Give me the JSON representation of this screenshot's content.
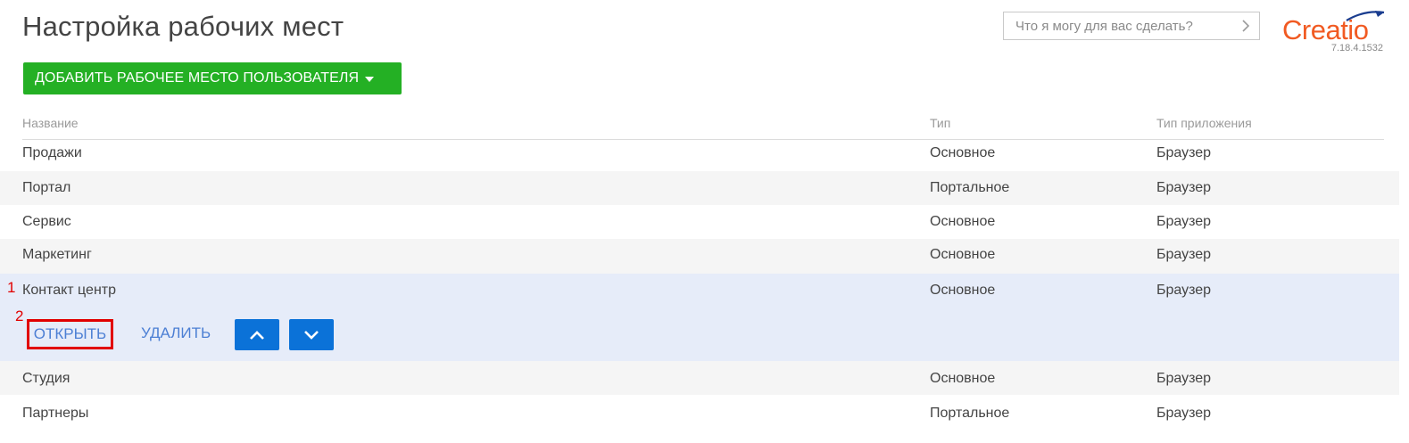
{
  "header": {
    "title": "Настройка рабочих мест",
    "search": {
      "placeholder": "Что я могу для вас сделать?"
    },
    "logo": {
      "text": "Creatio",
      "version": "7.18.4.1532",
      "brand_color": "#f15a22"
    }
  },
  "toolbar": {
    "add_button_label": "ДОБАВИТЬ РАБОЧЕЕ МЕСТО ПОЛЬЗОВАТЕЛЯ",
    "add_button_color": "#24b024"
  },
  "grid": {
    "columns": [
      "Название",
      "Тип",
      "Тип приложения"
    ],
    "rows": [
      {
        "name": "Продажи",
        "type": "Основное",
        "app_type": "Браузер"
      },
      {
        "name": "Портал",
        "type": "Портальное",
        "app_type": "Браузер"
      },
      {
        "name": "Сервис",
        "type": "Основное",
        "app_type": "Браузер"
      },
      {
        "name": "Маркетинг",
        "type": "Основное",
        "app_type": "Браузер"
      },
      {
        "name": "Контакт центр",
        "type": "Основное",
        "app_type": "Браузер",
        "selected": true
      },
      {
        "name": "Студия",
        "type": "Основное",
        "app_type": "Браузер"
      },
      {
        "name": "Партнеры",
        "type": "Портальное",
        "app_type": "Браузер"
      }
    ],
    "row_actions": {
      "open_label": "ОТКРЫТЬ",
      "delete_label": "УДАЛИТЬ",
      "move_up_icon": "chevron-up-icon",
      "move_down_icon": "chevron-down-icon"
    }
  },
  "annotations": {
    "marker_1": "1",
    "marker_2": "2",
    "highlight_color": "#e10000"
  }
}
